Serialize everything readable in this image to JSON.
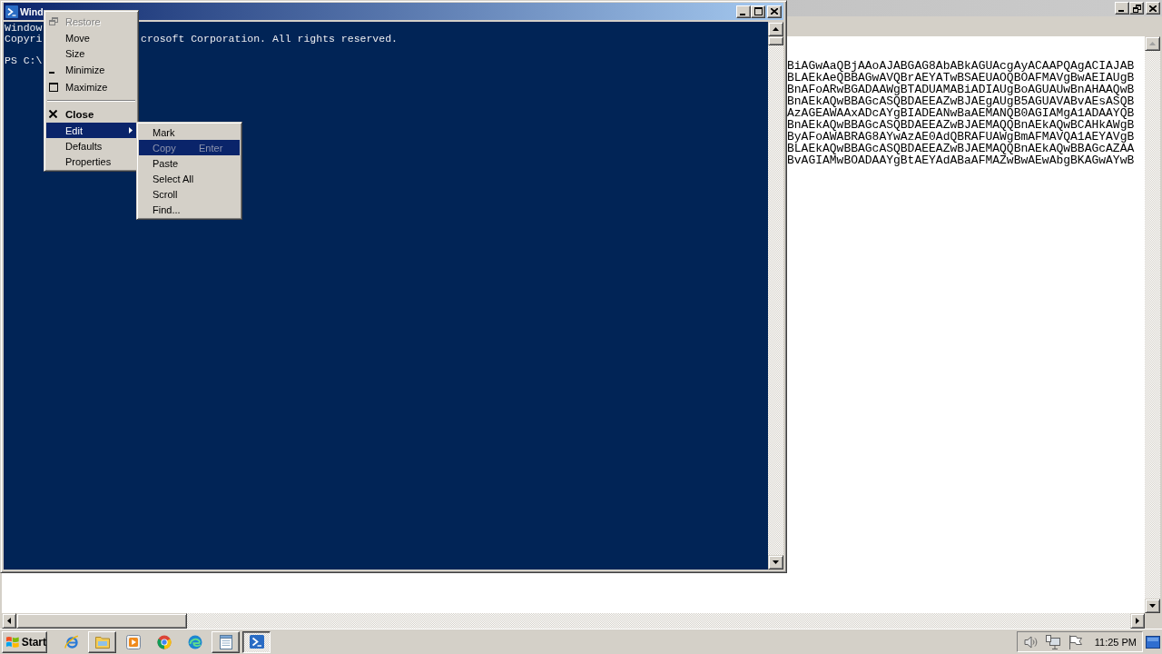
{
  "background_window": {
    "text_lines": [
      "BiAGwAaQBjAAoAJABGAG8AbABkAGUAcgAyACAAPQAgACIAJAB",
      "BLAEkAeQBBAGwAVQBrAEYATwBSAEUAOQBOAFMAVgBwAEIAUgB",
      "BnAFoARwBGADAAWgBTADUAMABiADIAUgBoAGUAUwBnAHAAQwB",
      "BnAEkAQwBBAGcASQBDAEEAZwBJAEgAUgB5AGUAVABvAEsASQB",
      "AzAGEAWAAxADcAYgBIADEANwBaAEMANQB0AGIAMgA1ADAAYQB",
      "BnAEkAQwBBAGcASQBDAEEAZwBJAEMAQQBnAEkAQwBCAHkAWgB",
      "ByAFoAWABRAG8AYwAzAE0AdQBRAFUAWgBmAFMAVQA1AEYAVgB",
      "BLAEkAQwBBAGcASQBDAEEAZwBJAEMAQQBnAEkAQwBBAGcAZAA",
      "BvAGIAMwBOADAAYgBtAEYAdABaAFMAZwBwAEwAbgBKAGwAYwB"
    ]
  },
  "console_window": {
    "title": "Wind",
    "lines": [
      {
        "kind": "output",
        "segments": [
          "Window"
        ]
      },
      {
        "kind": "output",
        "segments": [
          "Copyri",
          "crosoft Corporation. All rights reserved."
        ]
      },
      {
        "kind": "prompt",
        "segments": [
          "PS C:\\"
        ]
      }
    ]
  },
  "system_menu": {
    "items": [
      {
        "kind": "item",
        "label": "Restore",
        "disabled": true,
        "selected": false,
        "default": false
      },
      {
        "kind": "item",
        "label": "Move",
        "disabled": false,
        "selected": false,
        "default": false
      },
      {
        "kind": "item",
        "label": "Size",
        "disabled": false,
        "selected": false,
        "default": false
      },
      {
        "kind": "item",
        "label": "Minimize",
        "disabled": false,
        "selected": false,
        "default": false
      },
      {
        "kind": "item",
        "label": "Maximize",
        "disabled": false,
        "selected": false,
        "default": false
      },
      {
        "kind": "separator"
      },
      {
        "kind": "item",
        "label": "Close",
        "disabled": false,
        "selected": false,
        "default": true
      },
      {
        "kind": "item",
        "label": "Edit",
        "disabled": false,
        "selected": true,
        "default": false,
        "submenu": {
          "items": [
            {
              "label": "Mark",
              "disabled": false,
              "selected": false
            },
            {
              "label": "Copy",
              "shortcut": "Enter",
              "disabled": true,
              "selected": true
            },
            {
              "label": "Paste",
              "disabled": false,
              "selected": false
            },
            {
              "label": "Select All",
              "disabled": false,
              "selected": false
            },
            {
              "label": "Scroll",
              "disabled": false,
              "selected": false
            },
            {
              "label": "Find...",
              "disabled": false,
              "selected": false
            }
          ]
        }
      },
      {
        "kind": "item",
        "label": "Defaults",
        "disabled": false,
        "selected": false,
        "default": false
      },
      {
        "kind": "item",
        "label": "Properties",
        "disabled": false,
        "selected": false,
        "default": false
      }
    ]
  },
  "taskbar": {
    "start_label": "Start",
    "items": [
      {
        "kind": "pinned",
        "selected": false
      },
      {
        "kind": "window",
        "selected": false
      },
      {
        "kind": "pinned",
        "selected": false
      },
      {
        "kind": "pinned",
        "selected": false
      },
      {
        "kind": "pinned",
        "selected": false
      },
      {
        "kind": "window",
        "selected": false
      },
      {
        "kind": "window",
        "selected": true
      }
    ],
    "clock": "11:25 PM"
  }
}
